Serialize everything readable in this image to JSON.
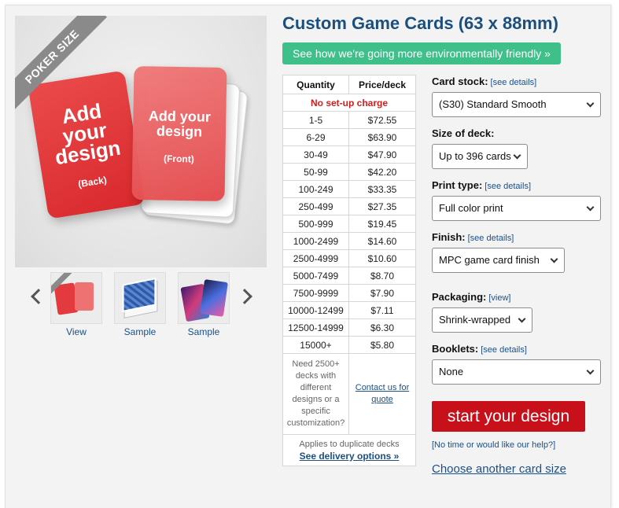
{
  "hero": {
    "ribbon": "POKER SIZE",
    "back_card": {
      "text": "Add your design",
      "sub": "(Back)"
    },
    "front_card": {
      "text": "Add your design",
      "sub": "(Front)"
    }
  },
  "thumbnails": [
    {
      "label": "View",
      "icon": "card-design-thumb-icon"
    },
    {
      "label": "Sample",
      "icon": "blue-deck-thumb-icon"
    },
    {
      "label": "Sample",
      "icon": "space-cards-thumb-icon"
    }
  ],
  "product": {
    "title": "Custom Game Cards (63 x 88mm)",
    "eco_banner": "See how we're going more environmentally friendly »"
  },
  "pricing": {
    "headers": [
      "Quantity",
      "Price/deck"
    ],
    "no_setup": "No set-up charge",
    "rows": [
      [
        "1-5",
        "$72.55"
      ],
      [
        "6-29",
        "$63.90"
      ],
      [
        "30-49",
        "$47.90"
      ],
      [
        "50-99",
        "$42.20"
      ],
      [
        "100-249",
        "$33.35"
      ],
      [
        "250-499",
        "$27.35"
      ],
      [
        "500-999",
        "$19.45"
      ],
      [
        "1000-2499",
        "$14.60"
      ],
      [
        "2500-4999",
        "$10.60"
      ],
      [
        "5000-7499",
        "$8.70"
      ],
      [
        "7500-9999",
        "$7.90"
      ],
      [
        "10000-12499",
        "$7.11"
      ],
      [
        "12500-14999",
        "$6.30"
      ],
      [
        "15000+",
        "$5.80"
      ]
    ],
    "note": "Need 2500+ decks with different designs or a specific customization?",
    "contact": "Contact us for quote",
    "duplicate_note": "Applies to duplicate decks",
    "delivery_link": "See delivery options »"
  },
  "options": {
    "card_stock": {
      "label": "Card stock:",
      "link": "[see details]",
      "value": "(S30) Standard Smooth"
    },
    "deck_size": {
      "label": "Size of deck:",
      "value": "Up to 396 cards"
    },
    "print_type": {
      "label": "Print type:",
      "link": "[see details]",
      "value": "Full color print"
    },
    "finish": {
      "label": "Finish:",
      "link": "[see details]",
      "value": "MPC game card finish"
    },
    "packaging": {
      "label": "Packaging:",
      "link": "[view]",
      "value": "Shrink-wrapped"
    },
    "booklets": {
      "label": "Booklets:",
      "link": "[see details]",
      "value": "None"
    }
  },
  "actions": {
    "start": "start your design",
    "help": "[No time or would like our help?]",
    "choose_size": "Choose another card size"
  },
  "colors": {
    "title": "#1d4f7d",
    "eco_banner": "#3fbf8a",
    "start_button": "#c8101a",
    "card_red": "#e53b3e",
    "link": "#1a5088"
  }
}
